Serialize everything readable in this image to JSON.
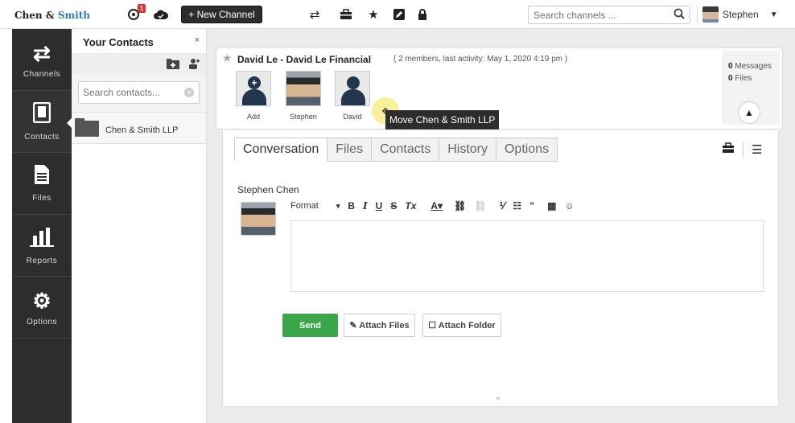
{
  "topbar": {
    "logo_main": "Chen &",
    "logo_accent": "Smith",
    "notification_count": "1",
    "new_channel_label": "+ New Channel",
    "search_placeholder": "Search channels ...",
    "user_name": "Stephen",
    "icons": [
      "notification-icon",
      "cloud-icon",
      "swap-icon",
      "briefcase-icon",
      "star-icon",
      "edit-icon",
      "lock-icon",
      "search-icon",
      "chevron-down-icon"
    ]
  },
  "leftnav": {
    "items": [
      {
        "label": "Channels",
        "icon": "swap-icon"
      },
      {
        "label": "Contacts",
        "icon": "book-icon"
      },
      {
        "label": "Files",
        "icon": "file-icon"
      },
      {
        "label": "Reports",
        "icon": "bar-chart-icon"
      },
      {
        "label": "Options",
        "icon": "gear-icon"
      }
    ],
    "active": "Contacts"
  },
  "contacts_panel": {
    "title": "Your Contacts",
    "close": "×",
    "search_placeholder": "Search contacts...",
    "items": [
      {
        "label": "Chen & Smith LLP"
      }
    ]
  },
  "channel": {
    "title": "David Le - David Le Financial",
    "meta": "( 2 members, last activity: May 1, 2020 4:19 pm )",
    "members": [
      {
        "name": "Add"
      },
      {
        "name": "Stephen"
      },
      {
        "name": "David"
      }
    ],
    "messages_count": "0",
    "messages_label": "Messages",
    "files_count": "0",
    "files_label": "Files"
  },
  "tooltip": "Move Chen & Smith LLP",
  "tabs": [
    "Conversation",
    "Files",
    "Contacts",
    "History",
    "Options"
  ],
  "active_tab": "Conversation",
  "composer": {
    "author": "Stephen Chen",
    "format_label": "Format",
    "send_label": "Send",
    "attach_files_label": "✎ Attach Files",
    "attach_folder_label": "☐ Attach Folder"
  },
  "colors": {
    "nav_bg": "#2d2d2d",
    "send_green": "#3aa64a",
    "brand_blue": "#2c7fb8",
    "badge_red": "#e03030"
  }
}
